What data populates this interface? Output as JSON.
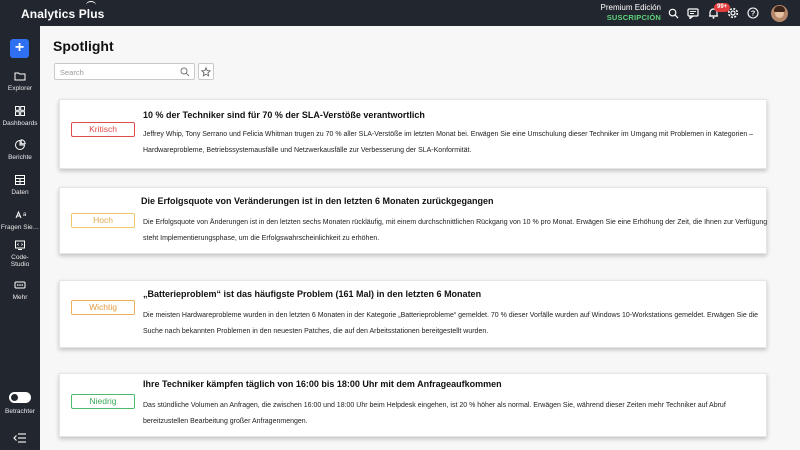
{
  "app": {
    "title": "Analytics Plus"
  },
  "plan": {
    "edition": "Premium Edición",
    "subscription": "SUSCRIPCIÓN"
  },
  "header": {
    "icons": [
      "search-icon",
      "message-icon",
      "bell-icon",
      "gear-icon",
      "help-icon"
    ],
    "notification_count": "99+"
  },
  "sidebar": {
    "add_label": "+",
    "items": [
      {
        "label": "Explorer",
        "icon": "folder-icon"
      },
      {
        "label": "Dashboards",
        "icon": "dashboard-icon"
      },
      {
        "label": "Berichte",
        "icon": "reports-icon"
      },
      {
        "label": "Daten",
        "icon": "table-icon"
      },
      {
        "label": "Fragen Sie…",
        "icon": "ask-icon"
      },
      {
        "label": "Code-Studio",
        "icon": "code-icon"
      },
      {
        "label": "Mehr",
        "icon": "more-icon"
      }
    ],
    "viewer_label": "Betrachter"
  },
  "main": {
    "title": "Spotlight",
    "search_placeholder": "Search"
  },
  "colors": {
    "kritisch": "#e04b4b",
    "hoch": "#f0c869",
    "wichtig": "#ecaf5a",
    "niedrig": "#4cbb6c"
  },
  "insights": [
    {
      "priority": "Kritisch",
      "title": "10 % der Techniker sind für 70 % der SLA-Verstöße verantwortlich",
      "description": "Jeffrey Whip, Tony Serrano und Felicia Whitman trugen zu 70 % aller SLA-Verstöße im letzten Monat bei. Erwägen Sie eine Umschulung dieser Techniker im Umgang mit Problemen in Kategorien – Hardwareprobleme, Betriebssystemausfälle und Netzwerkausfälle zur Verbesserung der SLA-Konformität."
    },
    {
      "priority": "Hoch",
      "title": "Die Erfolgsquote von Veränderungen ist in den letzten 6 Monaten zurückgegangen",
      "description": "Die Erfolgsquote von Änderungen ist in den letzten sechs Monaten rückläufig, mit einem durchschnittlichen Rückgang von 10 % pro Monat. Erwägen Sie eine Erhöhung der Zeit, die Ihnen zur Verfügung steht Implementierungsphase, um die Erfolgswahrscheinlichkeit zu erhöhen."
    },
    {
      "priority": "Wichtig",
      "title": "„Batterieproblem“ ist das häufigste Problem (161 Mal) in den letzten 6 Monaten",
      "description": "Die meisten Hardwareprobleme wurden in den letzten 6 Monaten in der Kategorie „Batterieprobleme“ gemeldet. 70 % dieser Vorfälle wurden auf Windows 10-Workstations gemeldet. Erwägen Sie die Suche nach bekannten Problemen in den neuesten Patches, die auf den Arbeitsstationen bereitgestellt wurden."
    },
    {
      "priority": "Niedrig",
      "title": "Ihre Techniker kämpfen täglich von 16:00 bis 18:00 Uhr mit dem Anfrageaufkommen",
      "description": "Das stündliche Volumen an Anfragen, die zwischen 16:00 und 18:00 Uhr beim Helpdesk eingehen, ist 20 % höher als normal. Erwägen Sie, während dieser Zeiten mehr Techniker auf Abruf bereitzustellen Bearbeitung großer Anfragenmengen."
    }
  ]
}
